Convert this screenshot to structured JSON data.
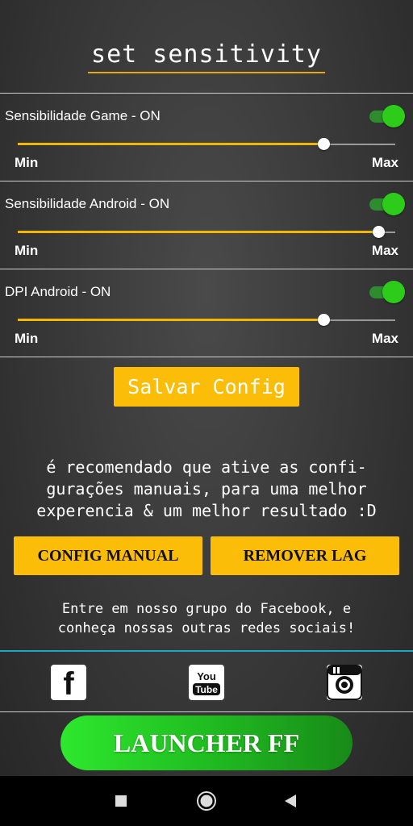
{
  "header": {
    "title": "set sensitivity"
  },
  "sections": [
    {
      "label": "Sensibilidade Game - ON",
      "enabled": true,
      "value": 0.81,
      "min_label": "Min",
      "max_label": "Max"
    },
    {
      "label": "Sensibilidade Android - ON",
      "enabled": true,
      "value": 0.955,
      "min_label": "Min",
      "max_label": "Max"
    },
    {
      "label": "DPI Android - ON",
      "enabled": true,
      "value": 0.81,
      "min_label": "Min",
      "max_label": "Max"
    }
  ],
  "save_button": "Salvar Config",
  "recommendation": "é recomendado que ative as confi-\ngurações manuais, para uma melhor\nexperencia & um melhor resultado :D",
  "actions": {
    "config_manual": "CONFIG MANUAL",
    "remover_lag": "REMOVER LAG"
  },
  "invite": "Entre em nosso grupo do Facebook, e\nconheça nossas outras redes sociais!",
  "social": {
    "facebook": "f",
    "youtube_top": "You",
    "youtube_bottom": "Tube"
  },
  "launcher": "LAUNCHER FF",
  "colors": {
    "accent": "#fbbd08",
    "toggle_on": "#2ecc1a",
    "divider": "#19a7c4"
  },
  "icons": [
    "facebook-icon",
    "youtube-icon",
    "instagram-icon",
    "recent-apps-icon",
    "home-icon",
    "back-icon"
  ]
}
